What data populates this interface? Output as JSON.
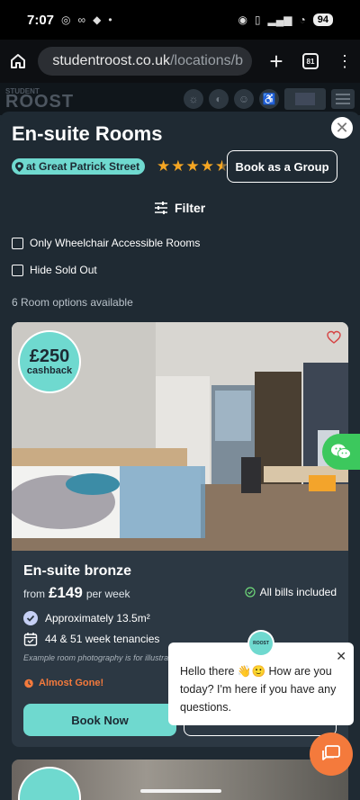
{
  "status_bar": {
    "time": "7:07",
    "battery": "94"
  },
  "browser": {
    "url_domain": "studentroost.co.uk",
    "url_path": "/locations/b",
    "tab_count": "81"
  },
  "site_header": {
    "logo_small": "STUDENT",
    "logo_big": "ROOST"
  },
  "modal": {
    "title": "En-suite Rooms",
    "location_label": "at Great Patrick Street",
    "rating": 4.5,
    "group_button": "Book as a Group",
    "filter_label": "Filter",
    "checkbox_wheelchair": "Only Wheelchair Accessible Rooms",
    "checkbox_sold_out": "Hide Sold Out",
    "options_count": "6 Room options available"
  },
  "room_card": {
    "cashback_amount": "£250",
    "cashback_label": "cashback",
    "name": "En-suite bronze",
    "price_prefix": "from",
    "price": "£149",
    "price_suffix": "per week",
    "bills": "All bills included",
    "size": "Approximately 13.5m²",
    "tenancies": "44 & 51 week tenancies",
    "disclaimer": "Example room photography is for illustra",
    "urgency": "Almost Gone!",
    "book_now": "Book Now"
  },
  "chat": {
    "avatar_text": "ROOST",
    "message": "Hello there 👋🙂 How are you today? I'm here if you have any questions."
  },
  "colors": {
    "accent": "#6fd9cf",
    "background": "#1f2a33",
    "card": "#2c3843",
    "star": "#f5a623",
    "urgency": "#f47a3c",
    "wechat": "#3cc85d"
  }
}
